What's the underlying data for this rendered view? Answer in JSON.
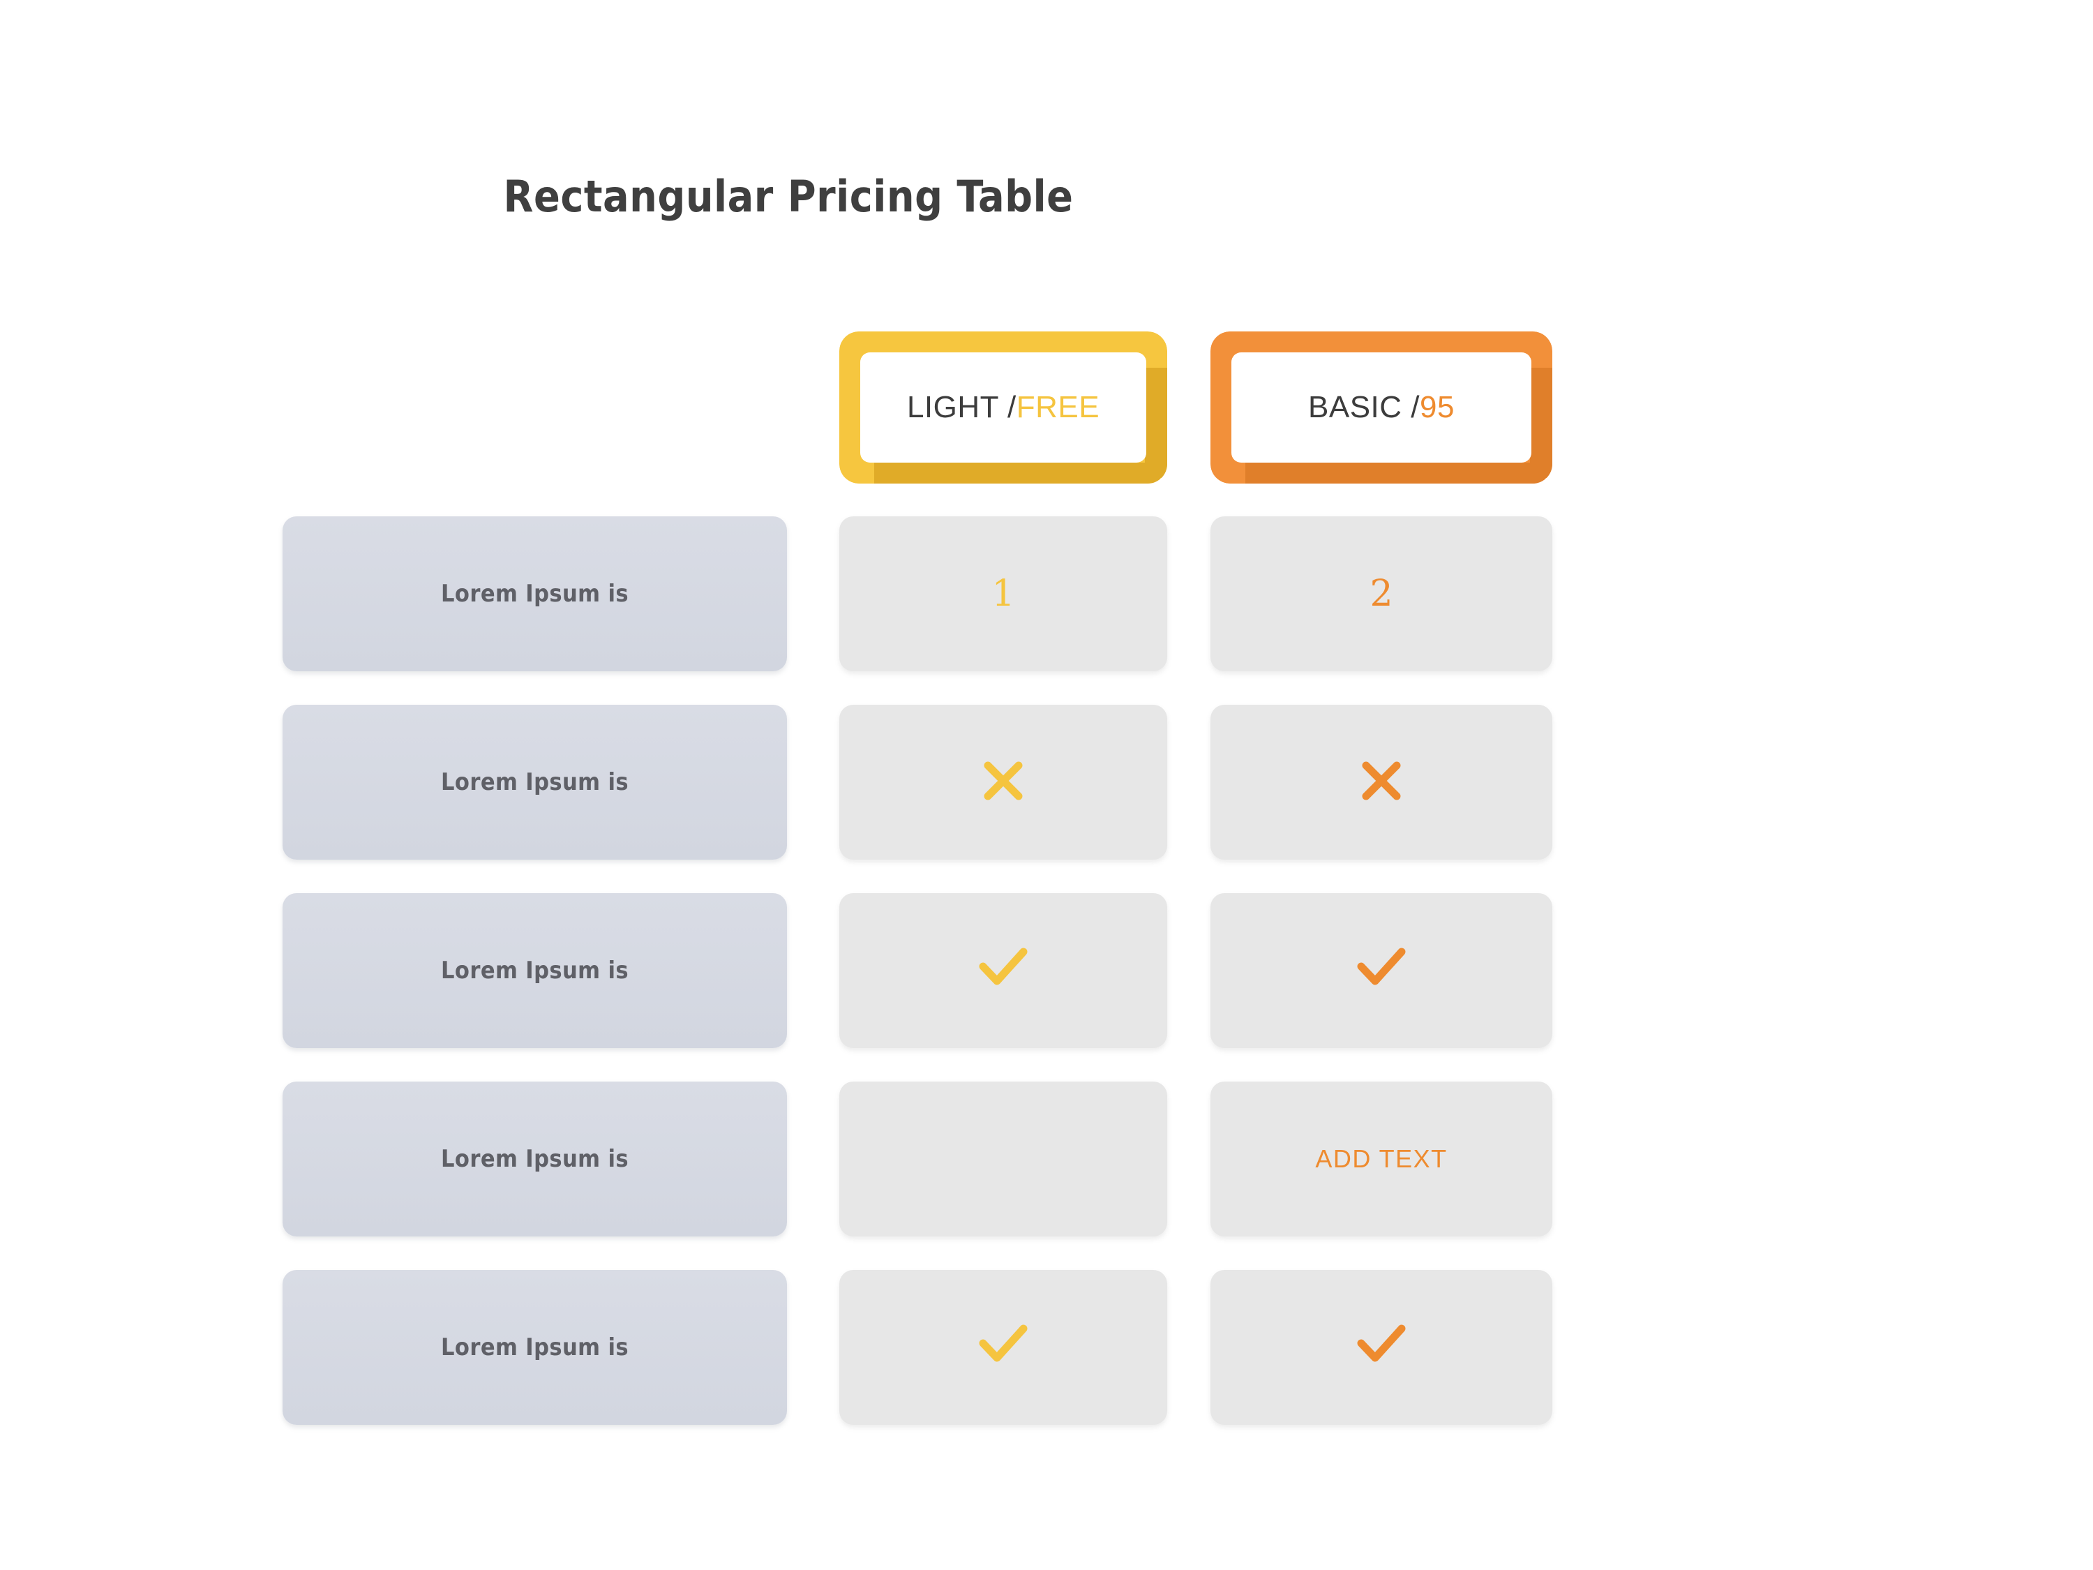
{
  "page": {
    "title": "Rectangular Pricing Table",
    "background": "#ffffff"
  },
  "colors": {
    "title_text": "#3f3f3f",
    "yellow": "#f5c43f",
    "yellow_frame": "#f6c63f",
    "yellow_shadow": "#e0ab28",
    "orange": "#ee8b2f",
    "orange_frame": "#f2903a",
    "orange_shadow": "#e07f2a",
    "label_cell_bg": "#d6dae3",
    "label_cell_text": "#5f6067",
    "value_cell_bg": "#e7e7e7",
    "plan_name_text": "#3c3c3c"
  },
  "plans": [
    {
      "id": "light",
      "name": "LIGHT /",
      "price": "FREE",
      "accent": "#f5c43f"
    },
    {
      "id": "basic",
      "name": "BASIC /",
      "price": "95",
      "accent": "#ee8b2f"
    }
  ],
  "rows": [
    {
      "label": "Lorem Ipsum is",
      "cells": [
        {
          "kind": "number",
          "value": "1",
          "tone": "yellow"
        },
        {
          "kind": "number",
          "value": "2",
          "tone": "orange"
        }
      ]
    },
    {
      "label": "Lorem Ipsum is",
      "cells": [
        {
          "kind": "cross",
          "value": "",
          "tone": "yellow"
        },
        {
          "kind": "cross",
          "value": "",
          "tone": "orange"
        }
      ]
    },
    {
      "label": "Lorem Ipsum is",
      "cells": [
        {
          "kind": "check",
          "value": "",
          "tone": "yellow"
        },
        {
          "kind": "check",
          "value": "",
          "tone": "orange"
        }
      ]
    },
    {
      "label": "Lorem Ipsum is",
      "cells": [
        {
          "kind": "empty",
          "value": "",
          "tone": "yellow"
        },
        {
          "kind": "text",
          "value": "ADD TEXT",
          "tone": "orange"
        }
      ]
    },
    {
      "label": "Lorem Ipsum is",
      "cells": [
        {
          "kind": "check",
          "value": "",
          "tone": "yellow"
        },
        {
          "kind": "check",
          "value": "",
          "tone": "orange"
        }
      ]
    }
  ]
}
